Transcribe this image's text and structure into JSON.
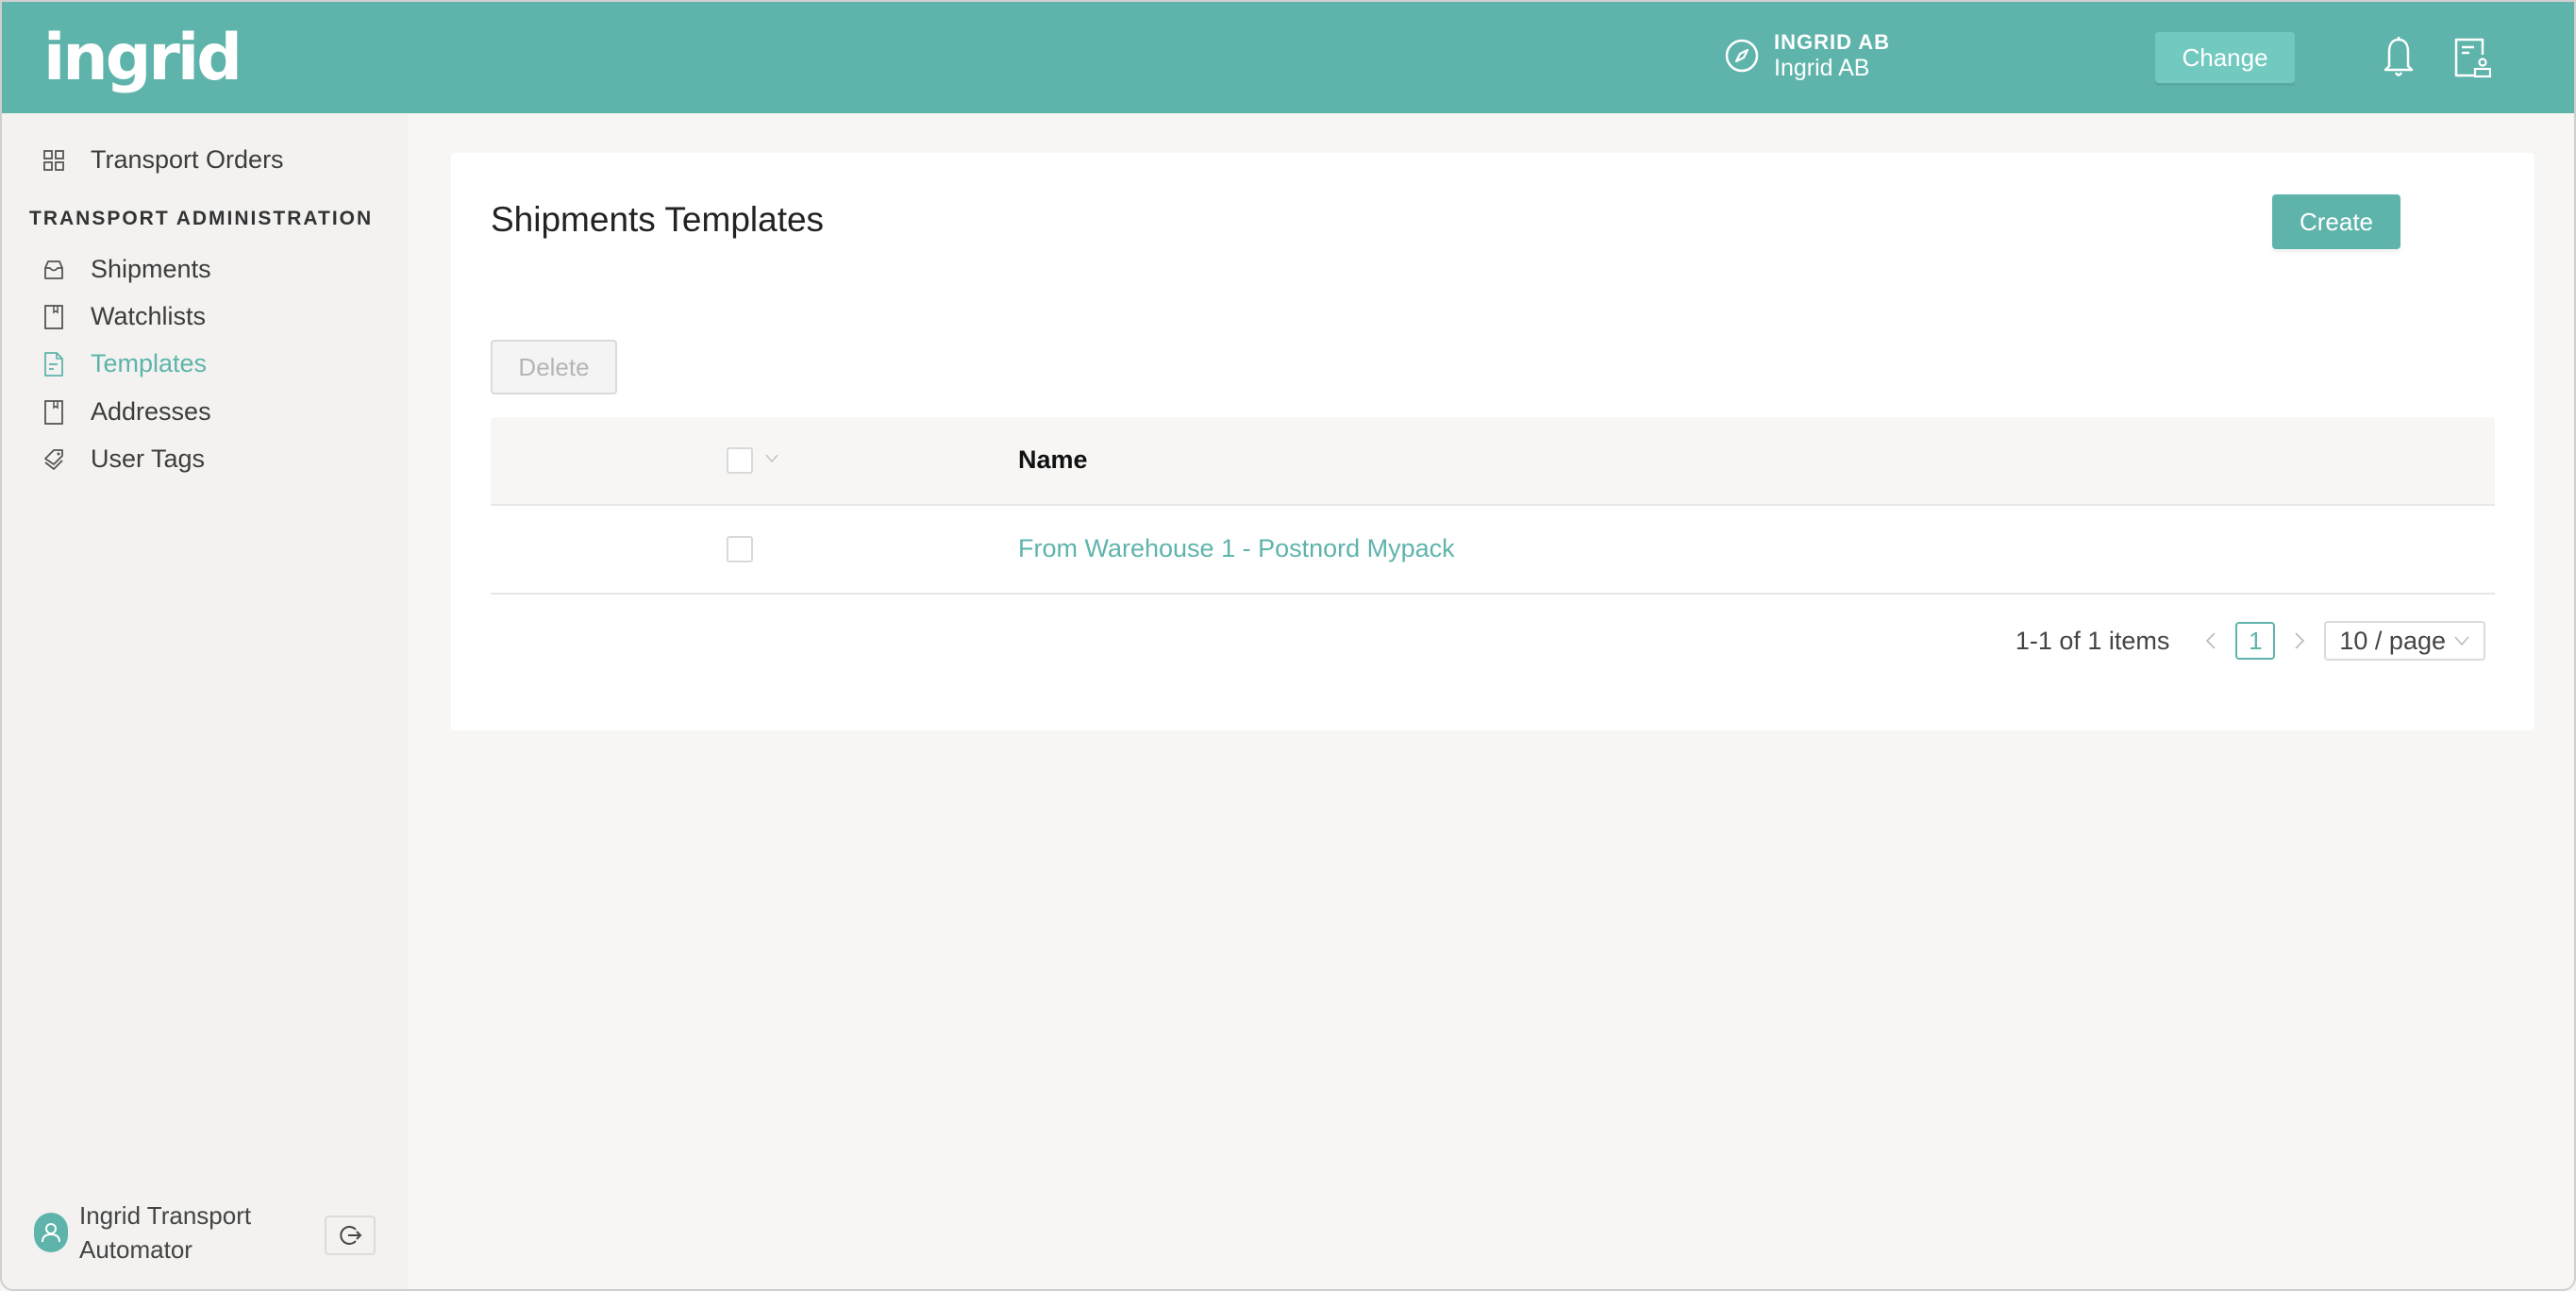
{
  "header": {
    "logo": "ingrid",
    "org_code": "INGRID AB",
    "org_name": "Ingrid AB",
    "change_label": "Change",
    "icons": [
      "compass-icon",
      "bell-icon",
      "document-user-icon"
    ]
  },
  "sidebar": {
    "top_item": {
      "label": "Transport Orders",
      "icon": "grid-icon"
    },
    "section_heading": "TRANSPORT ADMINISTRATION",
    "items": [
      {
        "label": "Shipments",
        "icon": "inbox-icon",
        "active": false
      },
      {
        "label": "Watchlists",
        "icon": "book-icon",
        "active": false
      },
      {
        "label": "Templates",
        "icon": "file-text-icon",
        "active": true
      },
      {
        "label": "Addresses",
        "icon": "book-icon",
        "active": false
      },
      {
        "label": "User Tags",
        "icon": "tags-icon",
        "active": false
      }
    ],
    "user": {
      "name": "Ingrid Transport Automator",
      "icon": "user-icon"
    },
    "logout_icon": "logout-icon"
  },
  "main": {
    "title": "Shipments Templates",
    "create_label": "Create",
    "delete_label": "Delete",
    "table": {
      "columns": [
        "Name"
      ],
      "rows": [
        {
          "name": "From Warehouse 1 - Postnord Mypack",
          "selected": false
        }
      ]
    },
    "pagination": {
      "total_text": "1-1 of 1 items",
      "current_page": "1",
      "page_size": "10 / page"
    }
  },
  "colors": {
    "brand": "#5eb4ab",
    "brand_light": "#72c9bf",
    "background": "#f7f6f4",
    "sidebar": "#f3f2f0"
  }
}
